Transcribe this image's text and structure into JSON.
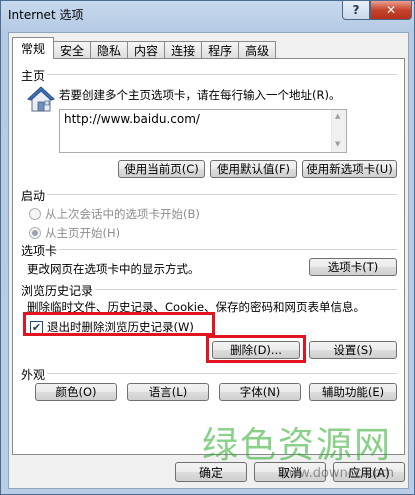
{
  "window": {
    "title": "Internet 选项",
    "help_glyph": "?",
    "close_glyph": "✕"
  },
  "tabs": [
    "常规",
    "安全",
    "隐私",
    "内容",
    "连接",
    "程序",
    "高级"
  ],
  "active_tab": "常规",
  "homepage": {
    "label": "主页",
    "hint": "若要创建多个主页选项卡，请在每行输入一个地址(R)。",
    "url_value": "http://www.baidu.com/",
    "icon": "house-icon",
    "buttons": [
      "使用当前页(C)",
      "使用默认值(F)",
      "使用新选项卡(U)"
    ]
  },
  "startup": {
    "label": "启动",
    "options": [
      {
        "label": "从上次会话中的选项卡开始(B)",
        "selected": false
      },
      {
        "label": "从主页开始(H)",
        "selected": true
      }
    ]
  },
  "tabs_section": {
    "label": "选项卡",
    "description": "更改网页在选项卡中的显示方式。",
    "button": "选项卡(T)"
  },
  "history": {
    "label": "浏览历史记录",
    "description": "删除临时文件、历史记录、Cookie、保存的密码和网页表单信息。",
    "checkbox_label": "退出时删除浏览历史记录(W)",
    "checkbox_checked": true,
    "delete_button": "删除(D)...",
    "settings_button": "设置(S)"
  },
  "appearance": {
    "label": "外观",
    "buttons": [
      "颜色(O)",
      "语言(L)",
      "字体(N)",
      "辅助功能(E)"
    ]
  },
  "footer": {
    "ok": "确定",
    "cancel": "取消",
    "apply": "应用(A)"
  },
  "watermark": {
    "cn": "绿色资源网",
    "en": "www.downcc.com"
  },
  "colors": {
    "highlight_box": "#e1141f",
    "close_button": "#c6432c",
    "watermark": "#28aa28"
  }
}
